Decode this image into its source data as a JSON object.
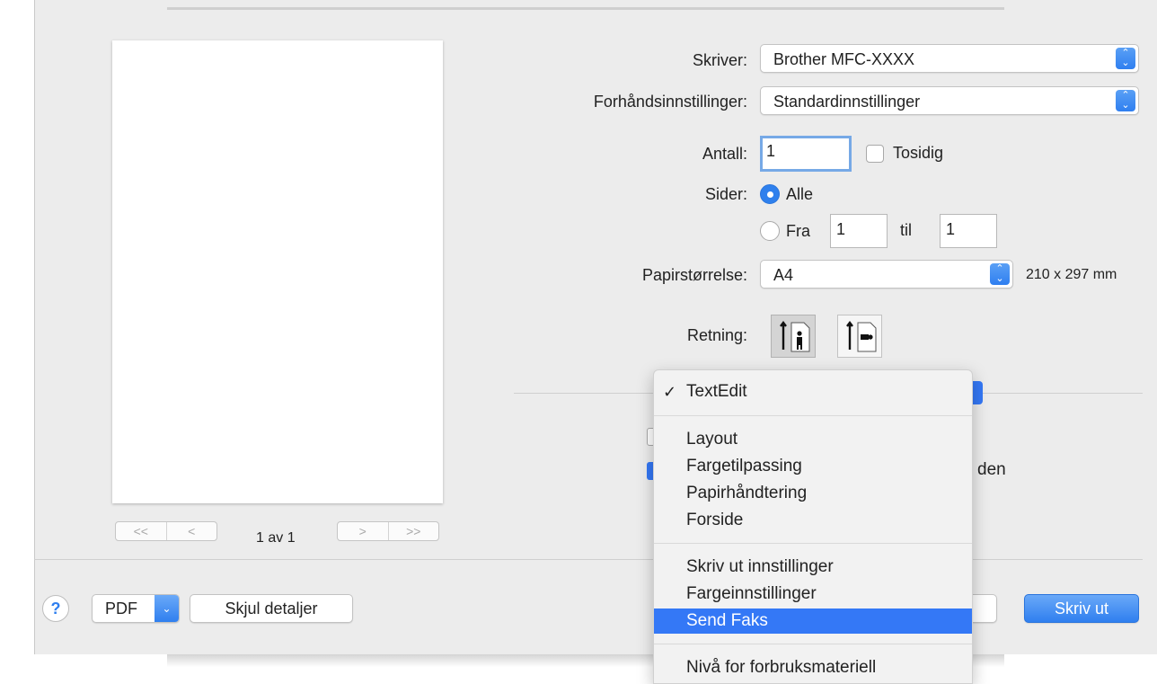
{
  "preview": {
    "page_count": "1 av 1",
    "nav_first": "<<",
    "nav_prev": "<",
    "nav_next": ">",
    "nav_last": ">>"
  },
  "printer": {
    "label": "Skriver:",
    "value": "Brother MFC-XXXX"
  },
  "presets": {
    "label": "Forhåndsinnstillinger:",
    "value": "Standardinnstillinger"
  },
  "copies": {
    "label": "Antall:",
    "value": "1",
    "duplex_label": "Tosidig"
  },
  "pages": {
    "label": "Sider:",
    "all_label": "Alle",
    "from_label": "Fra",
    "from_value": "1",
    "to_label": "til",
    "to_value": "1"
  },
  "paper": {
    "label": "Papirstørrelse:",
    "value": "A4",
    "size_text": "210 x 297 mm"
  },
  "orientation": {
    "label": "Retning:"
  },
  "partial_text": "den",
  "menu": {
    "current": "TextEdit",
    "group1": [
      "Layout",
      "Fargetilpassing",
      "Papirhåndtering",
      "Forside"
    ],
    "group2": [
      "Skriv ut innstillinger",
      "Fargeinnstillinger",
      "Send Faks"
    ],
    "group3": [
      "Nivå for forbruksmateriell"
    ],
    "selected": "Send Faks"
  },
  "buttons": {
    "help": "?",
    "pdf": "PDF",
    "hide_details": "Skjul detaljer",
    "print": "Skriv ut"
  },
  "colors": {
    "accent": "#3478f6",
    "window_bg": "#ececec"
  },
  "icons": {
    "portrait": "portrait-orientation-icon",
    "landscape": "landscape-orientation-icon",
    "stepper": "updown-chevron-icon",
    "dropdown": "chevron-down-icon",
    "check": "checkmark-icon"
  }
}
